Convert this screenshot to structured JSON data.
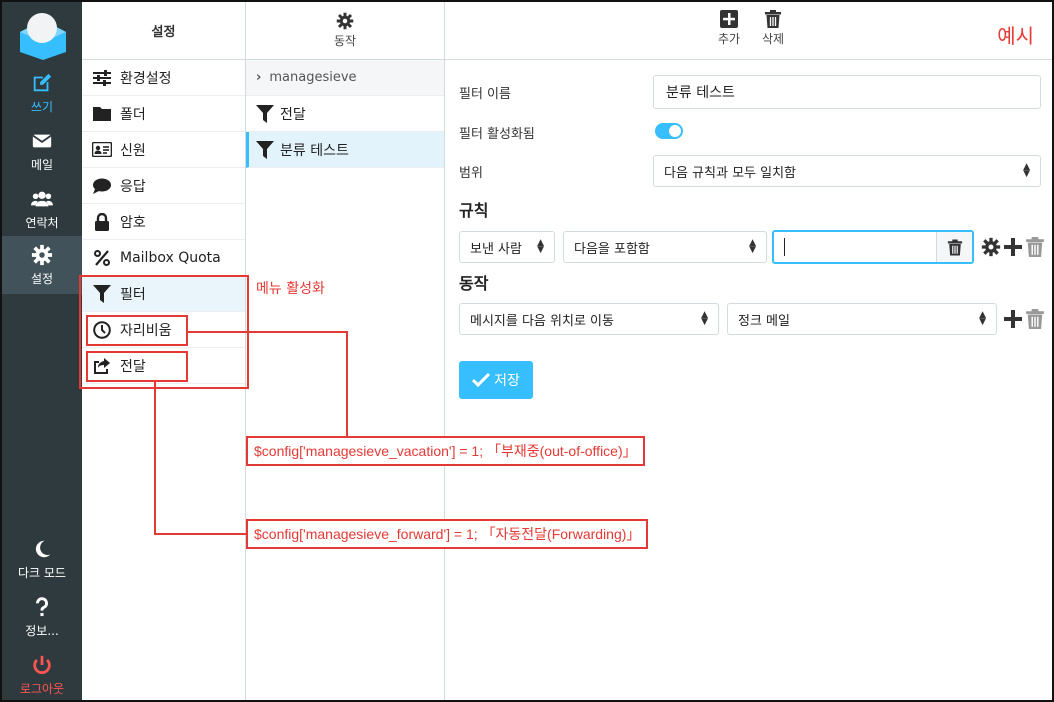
{
  "rail": {
    "compose": "쓰기",
    "mail": "메일",
    "contacts": "연락처",
    "settings": "설정",
    "dark_mode": "다크 모드",
    "about": "정보...",
    "logout": "로그아웃"
  },
  "settings_column": {
    "title": "설정",
    "items": [
      {
        "label": "환경설정",
        "icon": "sliders-icon"
      },
      {
        "label": "폴더",
        "icon": "folder-icon"
      },
      {
        "label": "신원",
        "icon": "id-card-icon"
      },
      {
        "label": "응답",
        "icon": "comment-icon"
      },
      {
        "label": "암호",
        "icon": "lock-icon"
      },
      {
        "label": "Mailbox Quota",
        "icon": "percent-icon"
      },
      {
        "label": "필터",
        "icon": "filter-icon"
      },
      {
        "label": "자리비움",
        "icon": "clock-icon"
      },
      {
        "label": "전달",
        "icon": "share-icon"
      }
    ]
  },
  "filters_column": {
    "action_label": "동작",
    "set_name": "managesieve",
    "filters": [
      "전달",
      "분류 테스트"
    ]
  },
  "toolbar": {
    "add": "추가",
    "delete": "삭제",
    "example": "예시"
  },
  "form": {
    "filter_name_label": "필터 이름",
    "filter_name_value": "분류 테스트",
    "enabled_label": "필터 활성화됨",
    "enabled": true,
    "scope_label": "범위",
    "scope_value": "다음 규칙과 모두 일치함",
    "rules_title": "규칙",
    "rule_header": "보낸 사람",
    "rule_op": "다음을 포함함",
    "rule_value": "",
    "actions_title": "동작",
    "action_type": "메시지를 다음 위치로 이동",
    "action_target": "정크 메일",
    "save": "저장"
  },
  "annotations": {
    "menu_activation": "메뉴 활성화",
    "vacation": "$config['managesieve_vacation'] = 1;   「부재중(out-of-office)」",
    "forward": "$config['managesieve_forward'] = 1;   「자동전달(Forwarding)」"
  },
  "colors": {
    "accent": "#37beff",
    "rail_bg": "#2f3a3f",
    "annotation": "#e53935"
  }
}
